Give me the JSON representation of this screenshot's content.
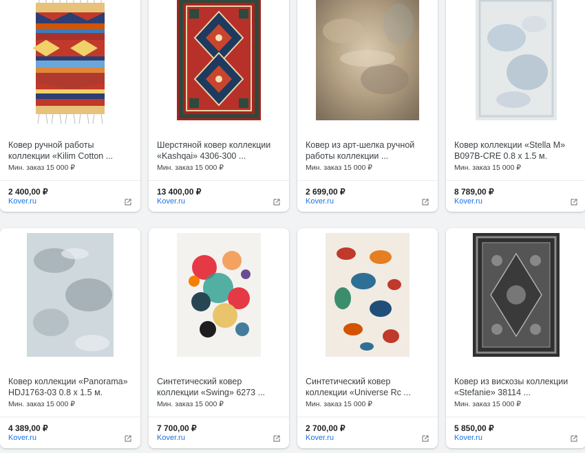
{
  "products": [
    {
      "title_line1": "Ковер ручной работы",
      "title_line2": "коллекции «Kilim Cotton ...",
      "min_order": "Мин. заказ 15 000 ₽",
      "price": "2 400,00 ₽",
      "seller": "Kover.ru",
      "image_icon": "rug-kilim-image"
    },
    {
      "title_line1": "Шерстяной ковер коллекции",
      "title_line2": "«Kashqai» 4306-300 ...",
      "min_order": "Мин. заказ 15 000 ₽",
      "price": "13 400,00 ₽",
      "seller": "Kover.ru",
      "image_icon": "rug-kashqai-image"
    },
    {
      "title_line1": "Ковер из арт-шелка ручной",
      "title_line2": "работы коллекции ...",
      "min_order": "Мин. заказ 15 000 ₽",
      "price": "2 699,00 ₽",
      "seller": "Kover.ru",
      "image_icon": "rug-artsilk-image"
    },
    {
      "title_line1": "Ковер коллекции «Stella M»",
      "title_line2": "B097B-CRE 0.8 x 1.5 м.",
      "min_order": "Мин. заказ 15 000 ₽",
      "price": "8 789,00 ₽",
      "seller": "Kover.ru",
      "image_icon": "rug-stella-image"
    },
    {
      "title_line1": "Ковер коллекции «Panorama»",
      "title_line2": "HDJ1763-03 0.8 x 1.5 м.",
      "min_order": "Мин. заказ 15 000 ₽",
      "price": "4 389,00 ₽",
      "seller": "Kover.ru",
      "image_icon": "rug-panorama-image"
    },
    {
      "title_line1": "Синтетический ковер",
      "title_line2": "коллекции «Swing» 6273 ...",
      "min_order": "Мин. заказ 15 000 ₽",
      "price": "7 700,00 ₽",
      "seller": "Kover.ru",
      "image_icon": "rug-swing-image"
    },
    {
      "title_line1": "Синтетический ковер",
      "title_line2": "коллекции «Universe Rc ...",
      "min_order": "Мин. заказ 15 000 ₽",
      "price": "2 700,00 ₽",
      "seller": "Kover.ru",
      "image_icon": "rug-universe-image"
    },
    {
      "title_line1": "Ковер из вискозы коллекции",
      "title_line2": "«Stefanie» 38114 ...",
      "min_order": "Мин. заказ 15 000 ₽",
      "price": "5 850,00 ₽",
      "seller": "Kover.ru",
      "image_icon": "rug-stefanie-image"
    }
  ],
  "colors": {
    "link": "#1a73e8",
    "card": "#ffffff",
    "page": "#f1f3f4"
  }
}
